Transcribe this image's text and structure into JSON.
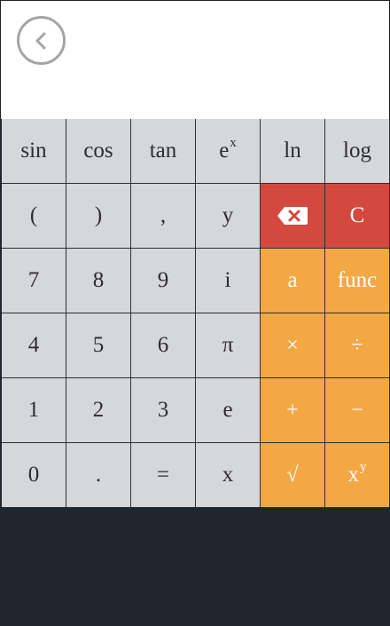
{
  "display": {
    "back_icon": "chevron-left-icon"
  },
  "keys": {
    "sin": "sin",
    "cos": "cos",
    "tan": "tan",
    "exp_base": "e",
    "exp_sup": "x",
    "ln": "ln",
    "log": "log",
    "open_paren": "(",
    "close_paren": ")",
    "comma": ",",
    "y": "y",
    "backspace_icon": "backspace-icon",
    "clear": "C",
    "seven": "7",
    "eight": "8",
    "nine": "9",
    "i": "i",
    "a": "a",
    "func": "func",
    "four": "4",
    "five": "5",
    "six": "6",
    "pi": "π",
    "multiply": "×",
    "divide": "÷",
    "one": "1",
    "two": "2",
    "three": "3",
    "e": "e",
    "plus": "+",
    "minus": "−",
    "zero": "0",
    "dot": ".",
    "equals": "=",
    "x": "x",
    "sqrt": "√",
    "power_base": "x",
    "power_sup": "y"
  },
  "colors": {
    "gray_key": "#d5d7da",
    "orange_key": "#f4a745",
    "red_key": "#d3493f",
    "background": "#20262d"
  }
}
